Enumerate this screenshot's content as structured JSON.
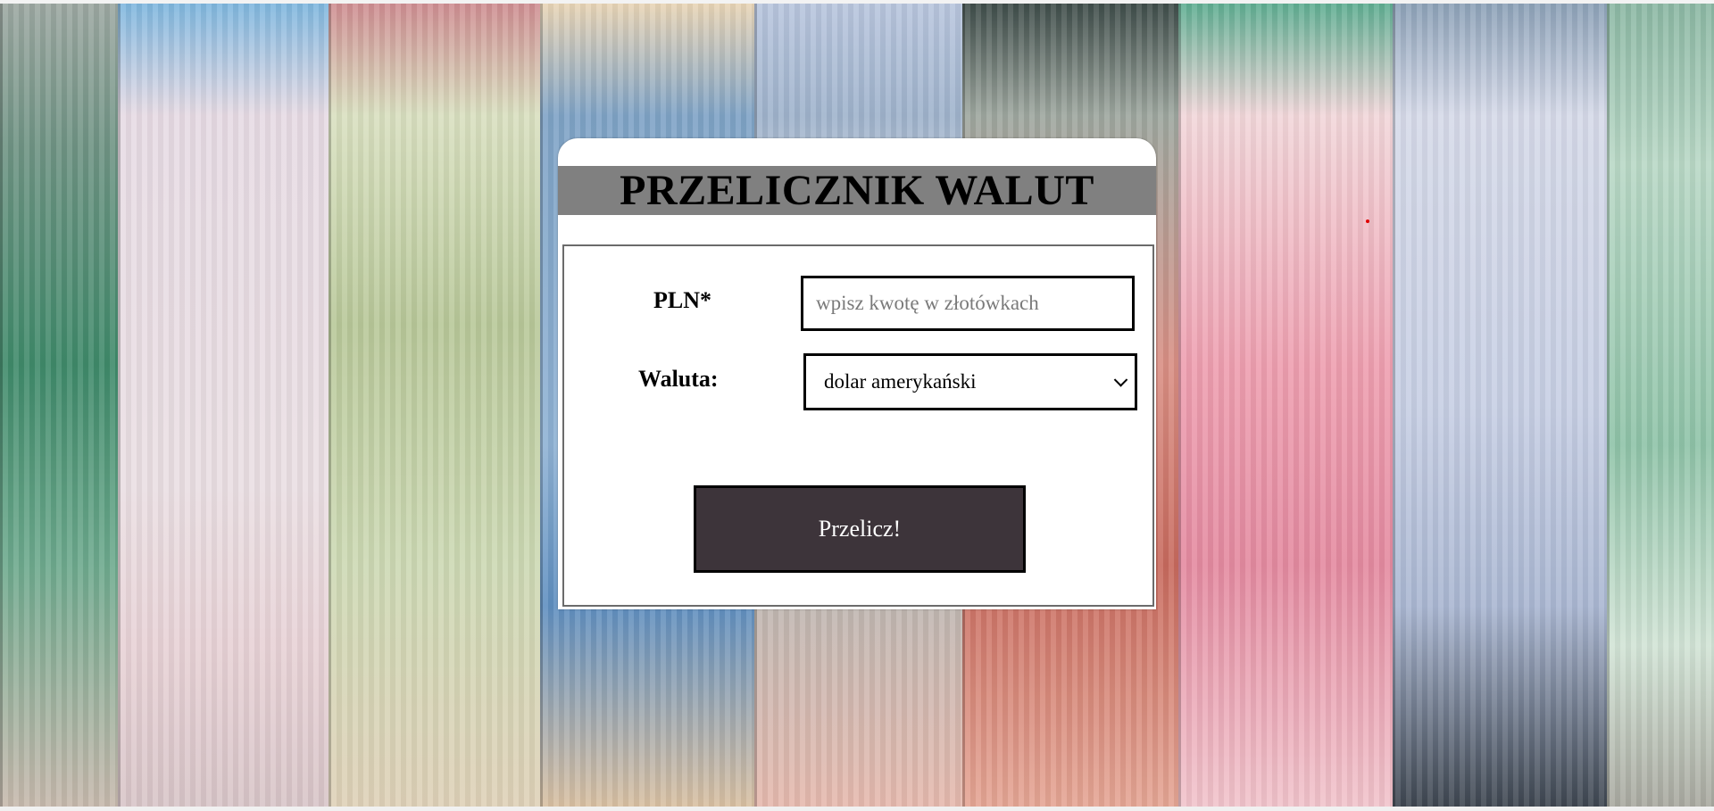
{
  "converter": {
    "title": "PRZELICZNIK WALUT",
    "amount_label": "PLN*",
    "amount_placeholder": "wpisz kwotę w złotówkach",
    "amount_value": "",
    "currency_label": "Waluta:",
    "currency_selected": "dolar amerykański",
    "convert_button": "Przelicz!"
  },
  "colors": {
    "title_band": "#808080",
    "button_bg": "#3d343a",
    "button_text": "#ffffff"
  },
  "icons": {
    "select": "chevron-down-icon"
  }
}
